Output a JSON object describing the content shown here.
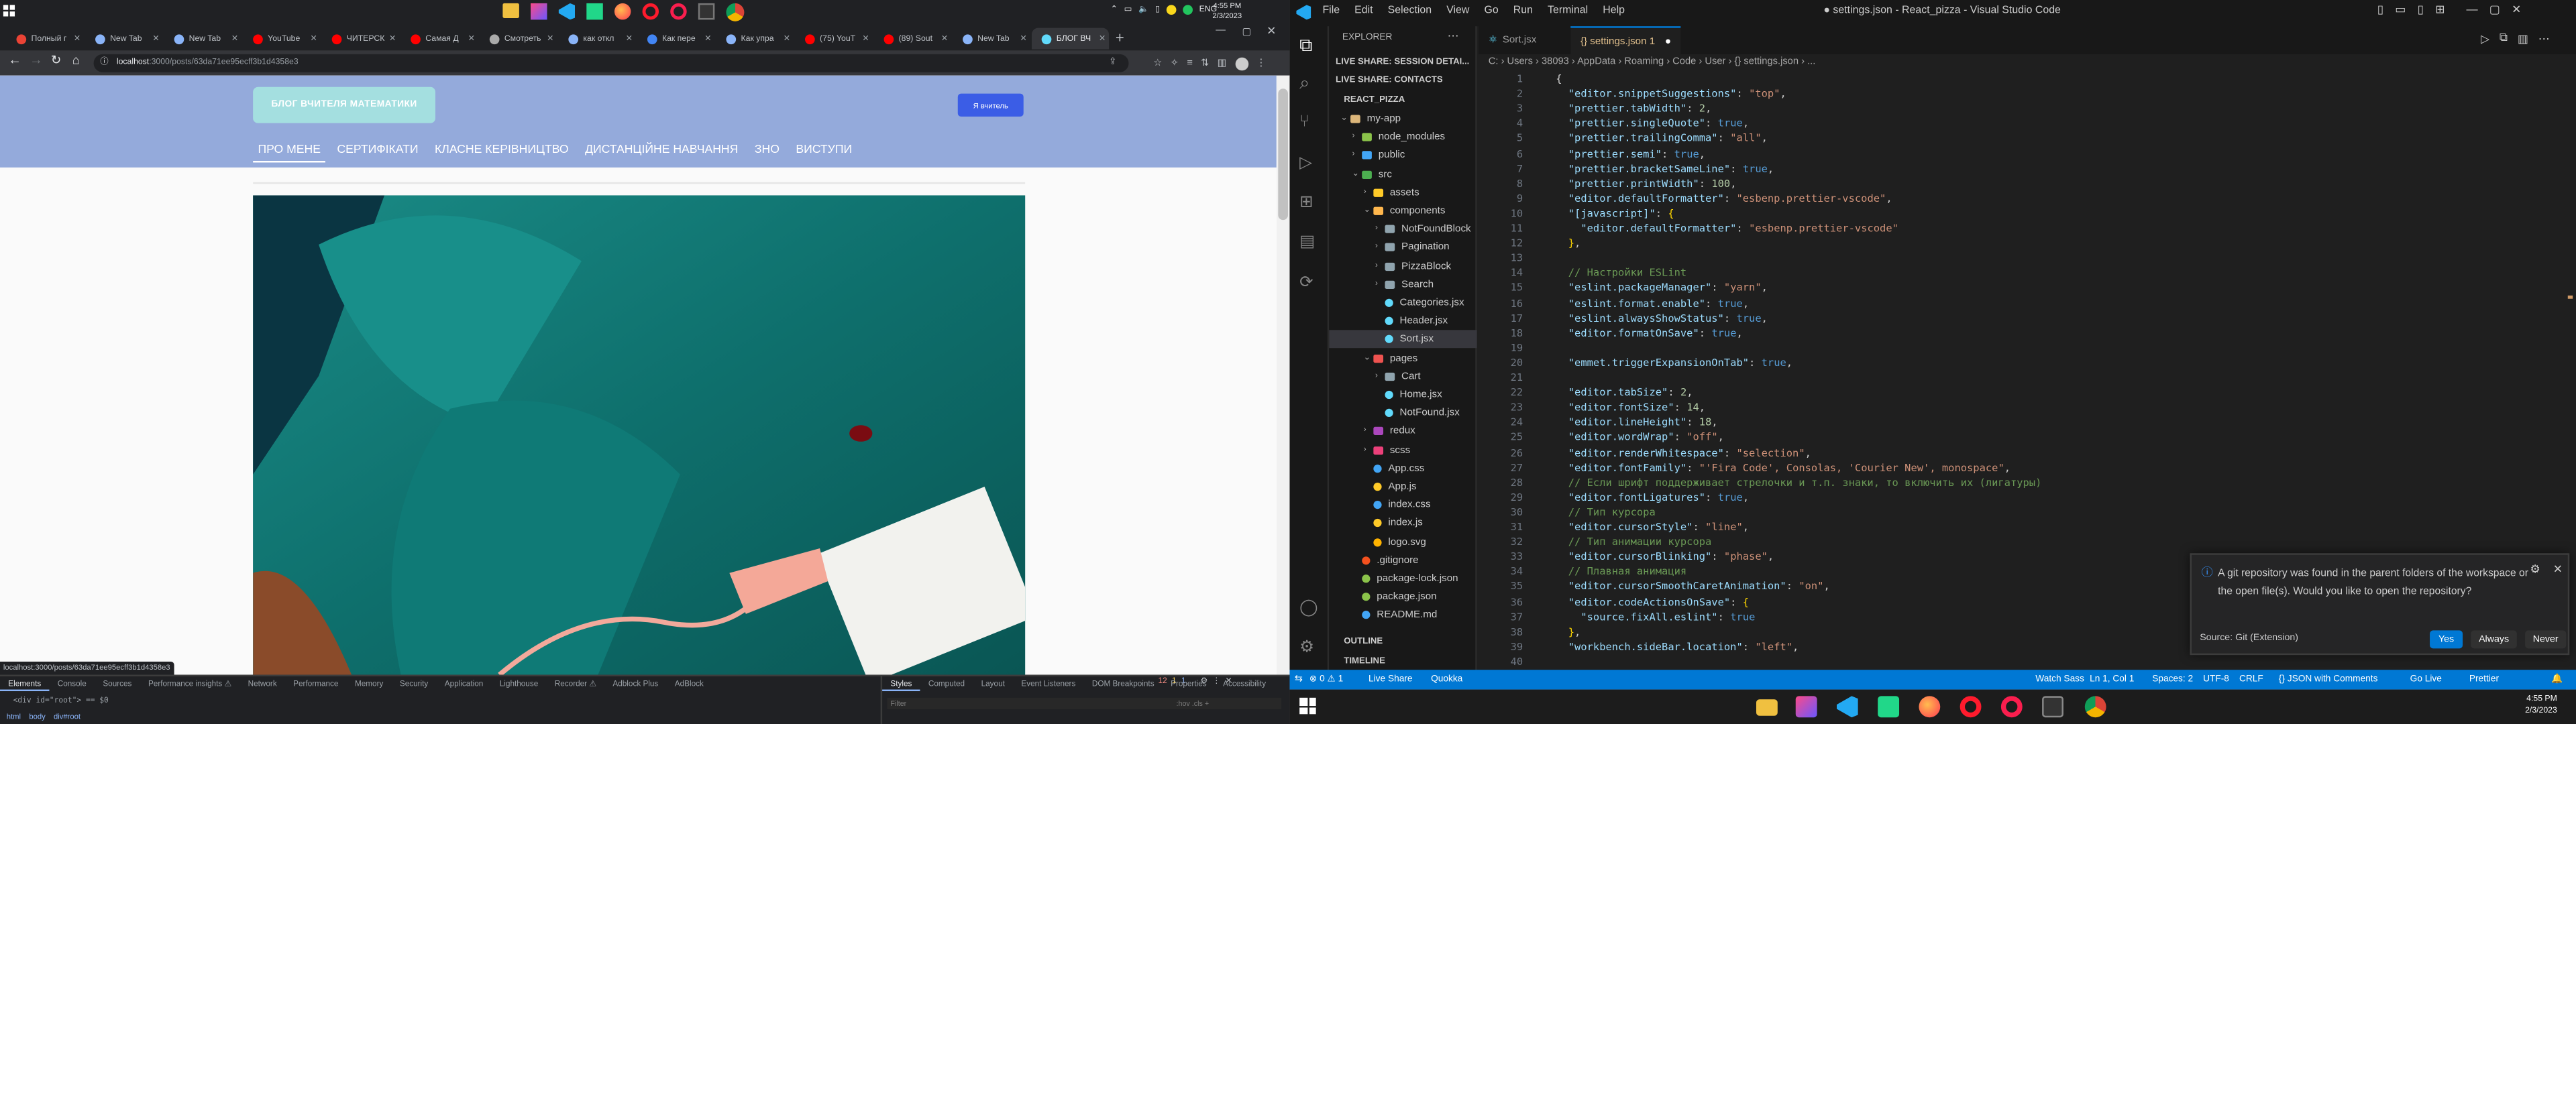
{
  "chrome": {
    "tabs": [
      {
        "title": "Полный г",
        "color": "#ea4335"
      },
      {
        "title": "New Tab",
        "color": "#8ab4f8"
      },
      {
        "title": "New Tab",
        "color": "#8ab4f8"
      },
      {
        "title": "YouTube",
        "color": "#ff0000"
      },
      {
        "title": "ЧИТЕРСК",
        "color": "#ff0000"
      },
      {
        "title": "Самая Д",
        "color": "#ff0000"
      },
      {
        "title": "Смотреть",
        "color": "#aaaaaa"
      },
      {
        "title": "как откл",
        "color": "#8ab4f8"
      },
      {
        "title": "Как пере",
        "color": "#4285f4"
      },
      {
        "title": "Как упра",
        "color": "#8ab4f8"
      },
      {
        "title": "(75) YouT",
        "color": "#ff0000"
      },
      {
        "title": "(89) Sout",
        "color": "#ff0000"
      },
      {
        "title": "New Tab",
        "color": "#8ab4f8"
      },
      {
        "title": "БЛОГ ВЧ",
        "color": "#61dafb",
        "active": true
      }
    ],
    "url_host": "localhost",
    "url_path": ":3000/posts/63da71ee95ecff3b1d4358e3",
    "status_link": "localhost:3000/posts/63da71ee95ecff3b1d4358e3"
  },
  "site": {
    "brand": "БЛОГ ВЧИТЕЛЯ МАТЕМАТИКИ",
    "teacher_button": "Я вчитель",
    "nav": [
      "ПРО МЕНЕ",
      "СЕРТИФІКАТИ",
      "КЛАСНЕ КЕРІВНИЦТВО",
      "ДИСТАНЦІЙНЕ НАВЧАННЯ",
      "ЗНО",
      "ВИСТУПИ"
    ]
  },
  "devtools": {
    "tabs": [
      "Elements",
      "Console",
      "Sources",
      "Performance insights ⚠",
      "Network",
      "Performance",
      "Memory",
      "Security",
      "Application",
      "Lighthouse",
      "Recorder ⚠",
      "Adblock Plus",
      "AdBlock"
    ],
    "badges": {
      "errors": "12",
      "warnings": "1",
      "info": "1"
    },
    "side_tabs": [
      "Styles",
      "Computed",
      "Layout",
      "Event Listeners",
      "DOM Breakpoints",
      "Properties",
      "Accessibility"
    ],
    "filter_placeholder": "Filter",
    "filter_hint": ":hov  .cls  +",
    "dom_line": "<div id=\"root\"> == $0",
    "crumbs": [
      "html",
      "body",
      "div#root"
    ]
  },
  "system_tray": {
    "lang": "ENG",
    "time": "4:55 PM",
    "date": "2/3/2023"
  },
  "vscode": {
    "menu": [
      "File",
      "Edit",
      "Selection",
      "View",
      "Go",
      "Run",
      "Terminal",
      "Help"
    ],
    "title": "● settings.json - React_pizza - Visual Studio Code",
    "explorer_title": "EXPLORER",
    "sections": [
      "LIVE SHARE: SESSION DETAI...",
      "LIVE SHARE: CONTACTS",
      "REACT_PIZZA",
      "OUTLINE",
      "TIMELINE"
    ],
    "tree": [
      {
        "label": "my-app",
        "indent": 1,
        "type": "folder-open",
        "color": "#dcb67a"
      },
      {
        "label": "node_modules",
        "indent": 2,
        "type": "folder",
        "color": "#8bc34a"
      },
      {
        "label": "public",
        "indent": 2,
        "type": "folder",
        "color": "#42a5f5"
      },
      {
        "label": "src",
        "indent": 2,
        "type": "folder-open",
        "color": "#4caf50"
      },
      {
        "label": "assets",
        "indent": 3,
        "type": "folder",
        "color": "#ffca28"
      },
      {
        "label": "components",
        "indent": 3,
        "type": "folder-open",
        "color": "#ffb74d"
      },
      {
        "label": "NotFoundBlock",
        "indent": 4,
        "type": "folder",
        "color": "#90a4ae"
      },
      {
        "label": "Pagination",
        "indent": 4,
        "type": "folder",
        "color": "#90a4ae"
      },
      {
        "label": "PizzaBlock",
        "indent": 4,
        "type": "folder",
        "color": "#90a4ae"
      },
      {
        "label": "Search",
        "indent": 4,
        "type": "folder",
        "color": "#90a4ae"
      },
      {
        "label": "Categories.jsx",
        "indent": 4,
        "type": "file",
        "color": "#61dafb"
      },
      {
        "label": "Header.jsx",
        "indent": 4,
        "type": "file",
        "color": "#61dafb"
      },
      {
        "label": "Sort.jsx",
        "indent": 4,
        "type": "file",
        "color": "#61dafb",
        "selected": true
      },
      {
        "label": "pages",
        "indent": 3,
        "type": "folder-open",
        "color": "#ef5350"
      },
      {
        "label": "Cart",
        "indent": 4,
        "type": "folder",
        "color": "#90a4ae"
      },
      {
        "label": "Home.jsx",
        "indent": 4,
        "type": "file",
        "color": "#61dafb"
      },
      {
        "label": "NotFound.jsx",
        "indent": 4,
        "type": "file",
        "color": "#61dafb"
      },
      {
        "label": "redux",
        "indent": 3,
        "type": "folder",
        "color": "#ab47bc"
      },
      {
        "label": "scss",
        "indent": 3,
        "type": "folder",
        "color": "#ec407a"
      },
      {
        "label": "App.css",
        "indent": 3,
        "type": "file",
        "color": "#42a5f5"
      },
      {
        "label": "App.js",
        "indent": 3,
        "type": "file",
        "color": "#ffca28"
      },
      {
        "label": "index.css",
        "indent": 3,
        "type": "file",
        "color": "#42a5f5"
      },
      {
        "label": "index.js",
        "indent": 3,
        "type": "file",
        "color": "#ffca28"
      },
      {
        "label": "logo.svg",
        "indent": 3,
        "type": "file",
        "color": "#ffb300"
      },
      {
        "label": ".gitignore",
        "indent": 2,
        "type": "file",
        "color": "#f4511e"
      },
      {
        "label": "package-lock.json",
        "indent": 2,
        "type": "file",
        "color": "#8bc34a"
      },
      {
        "label": "package.json",
        "indent": 2,
        "type": "file",
        "color": "#8bc34a"
      },
      {
        "label": "README.md",
        "indent": 2,
        "type": "file",
        "color": "#42a5f5"
      }
    ],
    "tabs": [
      {
        "label": "Sort.jsx",
        "active": false
      },
      {
        "label": "{} settings.json 1",
        "active": true
      }
    ],
    "breadcrumbs": "C: › Users › 38093 › AppData › Roaming › Code › User › {} settings.json › ...",
    "code": [
      [
        [
          "p",
          "{"
        ]
      ],
      [
        [
          "k",
          "  \"editor.snippetSuggestions\""
        ],
        [
          "p",
          ": "
        ],
        [
          "s",
          "\"top\""
        ],
        [
          "p",
          ","
        ]
      ],
      [
        [
          "k",
          "  \"prettier.tabWidth\""
        ],
        [
          "p",
          ": "
        ],
        [
          "n",
          "2"
        ],
        [
          "p",
          ","
        ]
      ],
      [
        [
          "k",
          "  \"prettier.singleQuote\""
        ],
        [
          "p",
          ": "
        ],
        [
          "b",
          "true"
        ],
        [
          "p",
          ","
        ]
      ],
      [
        [
          "k",
          "  \"prettier.trailingComma\""
        ],
        [
          "p",
          ": "
        ],
        [
          "s",
          "\"all\""
        ],
        [
          "p",
          ","
        ]
      ],
      [
        [
          "k",
          "  \"prettier.semi\""
        ],
        [
          "p",
          ": "
        ],
        [
          "b",
          "true"
        ],
        [
          "p",
          ","
        ]
      ],
      [
        [
          "k",
          "  \"prettier.bracketSameLine\""
        ],
        [
          "p",
          ": "
        ],
        [
          "b",
          "true"
        ],
        [
          "p",
          ","
        ]
      ],
      [
        [
          "k",
          "  \"prettier.printWidth\""
        ],
        [
          "p",
          ": "
        ],
        [
          "n",
          "100"
        ],
        [
          "p",
          ","
        ]
      ],
      [
        [
          "k",
          "  \"editor.defaultFormatter\""
        ],
        [
          "p",
          ": "
        ],
        [
          "s",
          "\"esbenp.prettier-vscode\""
        ],
        [
          "p",
          ","
        ]
      ],
      [
        [
          "k",
          "  \"[javascript]\""
        ],
        [
          "p",
          ": "
        ],
        [
          "y",
          "{"
        ]
      ],
      [
        [
          "k",
          "    \"editor.defaultFormatter\""
        ],
        [
          "p",
          ": "
        ],
        [
          "s",
          "\"esbenp.prettier-vscode\""
        ]
      ],
      [
        [
          "y",
          "  }"
        ],
        [
          "p",
          ","
        ]
      ],
      [
        [
          "p",
          ""
        ]
      ],
      [
        [
          "c",
          "  // Настройки ESLint"
        ]
      ],
      [
        [
          "k",
          "  \"eslint.packageManager\""
        ],
        [
          "p",
          ": "
        ],
        [
          "s",
          "\"yarn\""
        ],
        [
          "p",
          ","
        ]
      ],
      [
        [
          "k",
          "  \"eslint.format.enable\""
        ],
        [
          "p",
          ": "
        ],
        [
          "b",
          "true"
        ],
        [
          "p",
          ","
        ]
      ],
      [
        [
          "k",
          "  \"eslint.alwaysShowStatus\""
        ],
        [
          "p",
          ": "
        ],
        [
          "b",
          "true"
        ],
        [
          "p",
          ","
        ]
      ],
      [
        [
          "k",
          "  \"editor.formatOnSave\""
        ],
        [
          "p",
          ": "
        ],
        [
          "b",
          "true"
        ],
        [
          "p",
          ","
        ]
      ],
      [
        [
          "p",
          ""
        ]
      ],
      [
        [
          "k",
          "  \"emmet.triggerExpansionOnTab\""
        ],
        [
          "p",
          ": "
        ],
        [
          "b",
          "true"
        ],
        [
          "p",
          ","
        ]
      ],
      [
        [
          "p",
          ""
        ]
      ],
      [
        [
          "k",
          "  \"editor.tabSize\""
        ],
        [
          "p",
          ": "
        ],
        [
          "n",
          "2"
        ],
        [
          "p",
          ","
        ]
      ],
      [
        [
          "k",
          "  \"editor.fontSize\""
        ],
        [
          "p",
          ": "
        ],
        [
          "n",
          "14"
        ],
        [
          "p",
          ","
        ]
      ],
      [
        [
          "k",
          "  \"editor.lineHeight\""
        ],
        [
          "p",
          ": "
        ],
        [
          "n",
          "18"
        ],
        [
          "p",
          ","
        ]
      ],
      [
        [
          "k",
          "  \"editor.wordWrap\""
        ],
        [
          "p",
          ": "
        ],
        [
          "s",
          "\"off\""
        ],
        [
          "p",
          ","
        ]
      ],
      [
        [
          "k",
          "  \"editor.renderWhitespace\""
        ],
        [
          "p",
          ": "
        ],
        [
          "s",
          "\"selection\""
        ],
        [
          "p",
          ","
        ]
      ],
      [
        [
          "k",
          "  \"editor.fontFamily\""
        ],
        [
          "p",
          ": "
        ],
        [
          "s",
          "\"'Fira Code', Consolas, 'Courier New', monospace\""
        ],
        [
          "p",
          ","
        ]
      ],
      [
        [
          "c",
          "  // Если шрифт поддерживает стрелочки и т.п. знаки, то включить их (лигатуры)"
        ]
      ],
      [
        [
          "k",
          "  \"editor.fontLigatures\""
        ],
        [
          "p",
          ": "
        ],
        [
          "b",
          "true"
        ],
        [
          "p",
          ","
        ]
      ],
      [
        [
          "c",
          "  // Тип курсора"
        ]
      ],
      [
        [
          "k",
          "  \"editor.cursorStyle\""
        ],
        [
          "p",
          ": "
        ],
        [
          "s",
          "\"line\""
        ],
        [
          "p",
          ","
        ]
      ],
      [
        [
          "c",
          "  // Тип анимации курсора"
        ]
      ],
      [
        [
          "k",
          "  \"editor.cursorBlinking\""
        ],
        [
          "p",
          ": "
        ],
        [
          "s",
          "\"phase\""
        ],
        [
          "p",
          ","
        ]
      ],
      [
        [
          "c",
          "  // Плавная анимация"
        ]
      ],
      [
        [
          "k",
          "  \"editor.cursorSmoothCaretAnimation\""
        ],
        [
          "p",
          ": "
        ],
        [
          "s",
          "\"on\""
        ],
        [
          "p",
          ","
        ]
      ],
      [
        [
          "k",
          "  \"editor.codeActionsOnSave\""
        ],
        [
          "p",
          ": "
        ],
        [
          "y",
          "{"
        ]
      ],
      [
        [
          "k",
          "    \"source.fixAll.eslint\""
        ],
        [
          "p",
          ": "
        ],
        [
          "b",
          "true"
        ]
      ],
      [
        [
          "y",
          "  }"
        ],
        [
          "p",
          ","
        ]
      ],
      [
        [
          "k",
          "  \"workbench.sideBar.location\""
        ],
        [
          "p",
          ": "
        ],
        [
          "s",
          "\"left\""
        ],
        [
          "p",
          ","
        ]
      ],
      [
        [
          "p",
          ""
        ]
      ]
    ],
    "notification": {
      "message": "A git repository was found in the parent folders of the workspace or the open file(s). Would you like to open the repository?",
      "source": "Source: Git (Extension)",
      "buttons": [
        "Yes",
        "Always",
        "Never"
      ]
    },
    "status": {
      "problems": "⊗ 0  ⚠ 1",
      "live_share": "Live Share",
      "quokka": "Quokka",
      "watch_sass": "Watch Sass",
      "position": "Ln 1, Col 1",
      "spaces": "Spaces: 2",
      "encoding": "UTF-8",
      "eol": "CRLF",
      "language": "{} JSON with Comments",
      "go_live": "Go Live",
      "prettier": "Prettier"
    }
  }
}
